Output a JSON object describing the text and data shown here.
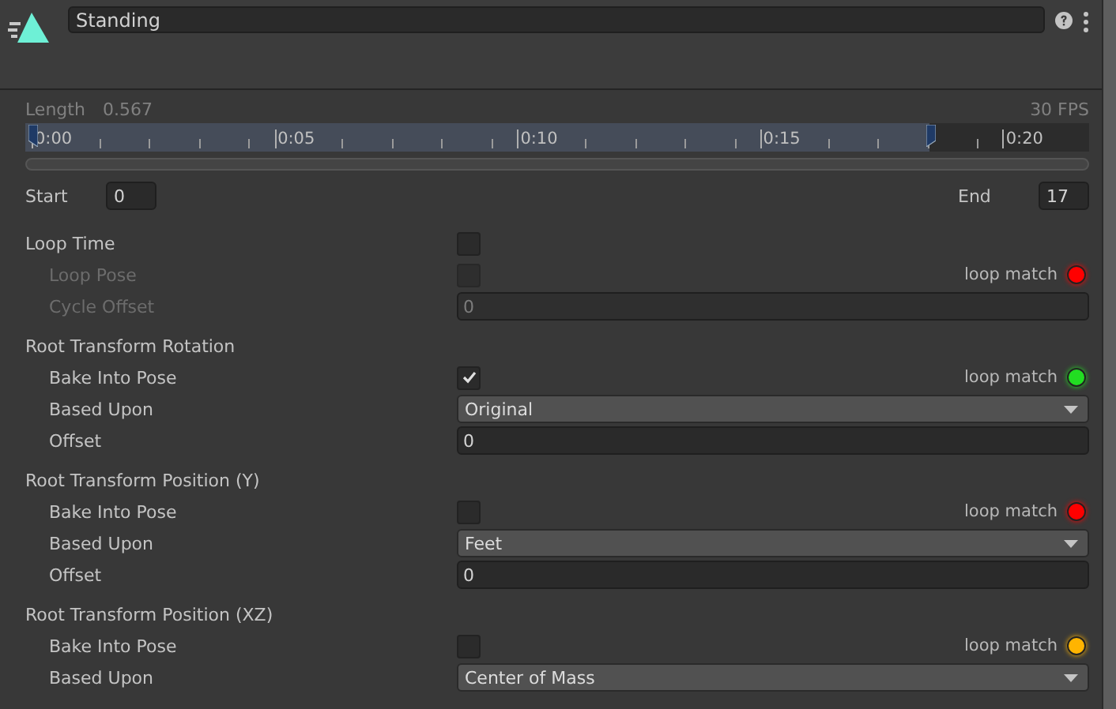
{
  "header": {
    "name": "Standing"
  },
  "clip_info": {
    "length_label": "Length",
    "length_value": "0.567",
    "fps": "30 FPS"
  },
  "timeline": {
    "labels": [
      "0:00",
      "0:05",
      "0:10",
      "0:15",
      "0:20"
    ],
    "level": 0.85
  },
  "range": {
    "start_label": "Start",
    "start_value": "0",
    "end_label": "End",
    "end_value": "17"
  },
  "settings": [
    {
      "label": "Loop Time",
      "kind": "checkbox",
      "checked": false,
      "children": [
        {
          "label": "Loop Pose",
          "kind": "checkbox",
          "checked": false,
          "disabled": true,
          "loop_match": {
            "label": "loop match",
            "color": "#ff0000"
          }
        },
        {
          "label": "Cycle Offset",
          "kind": "number",
          "value": "0",
          "disabled": true
        }
      ]
    },
    {
      "label": "Root Transform Rotation",
      "kind": "group",
      "children": [
        {
          "label": "Bake Into Pose",
          "kind": "checkbox",
          "checked": true,
          "disabled": false,
          "loop_match": {
            "label": "loop match",
            "color": "#22dd22"
          }
        },
        {
          "label": "Based Upon",
          "kind": "dropdown",
          "value": "Original",
          "disabled": false
        },
        {
          "label": "Offset",
          "kind": "number",
          "value": "0",
          "disabled": false
        }
      ]
    },
    {
      "label": "Root Transform Position (Y)",
      "kind": "group",
      "children": [
        {
          "label": "Bake Into Pose",
          "kind": "checkbox",
          "checked": false,
          "disabled": false,
          "loop_match": {
            "label": "loop match",
            "color": "#ff0000"
          }
        },
        {
          "label": "Based Upon",
          "kind": "dropdown",
          "value": "Feet",
          "disabled": false
        },
        {
          "label": "Offset",
          "kind": "number",
          "value": "0",
          "disabled": false
        }
      ]
    },
    {
      "label": "Root Transform Position (XZ)",
      "kind": "group",
      "children": [
        {
          "label": "Bake Into Pose",
          "kind": "checkbox",
          "checked": false,
          "disabled": false,
          "loop_match": {
            "label": "loop match",
            "color": "#ffb400"
          }
        },
        {
          "label": "Based Upon",
          "kind": "dropdown",
          "value": "Center of Mass",
          "disabled": false
        }
      ]
    }
  ]
}
